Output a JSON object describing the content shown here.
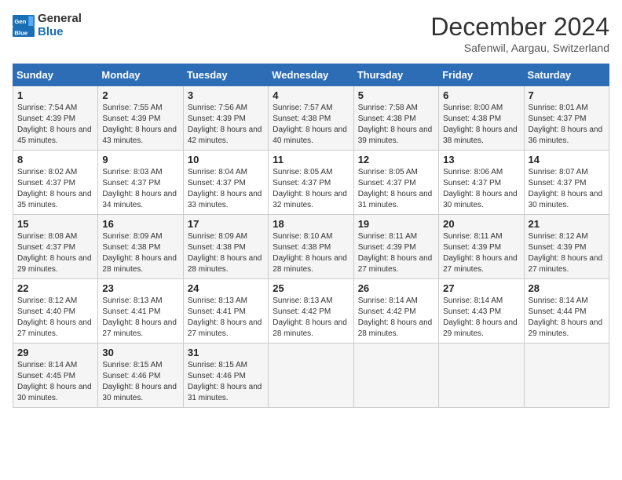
{
  "logo": {
    "general": "General",
    "blue": "Blue"
  },
  "title": "December 2024",
  "location": "Safenwil, Aargau, Switzerland",
  "days_of_week": [
    "Sunday",
    "Monday",
    "Tuesday",
    "Wednesday",
    "Thursday",
    "Friday",
    "Saturday"
  ],
  "weeks": [
    [
      {
        "day": "1",
        "sunrise": "Sunrise: 7:54 AM",
        "sunset": "Sunset: 4:39 PM",
        "daylight": "Daylight: 8 hours and 45 minutes."
      },
      {
        "day": "2",
        "sunrise": "Sunrise: 7:55 AM",
        "sunset": "Sunset: 4:39 PM",
        "daylight": "Daylight: 8 hours and 43 minutes."
      },
      {
        "day": "3",
        "sunrise": "Sunrise: 7:56 AM",
        "sunset": "Sunset: 4:39 PM",
        "daylight": "Daylight: 8 hours and 42 minutes."
      },
      {
        "day": "4",
        "sunrise": "Sunrise: 7:57 AM",
        "sunset": "Sunset: 4:38 PM",
        "daylight": "Daylight: 8 hours and 40 minutes."
      },
      {
        "day": "5",
        "sunrise": "Sunrise: 7:58 AM",
        "sunset": "Sunset: 4:38 PM",
        "daylight": "Daylight: 8 hours and 39 minutes."
      },
      {
        "day": "6",
        "sunrise": "Sunrise: 8:00 AM",
        "sunset": "Sunset: 4:38 PM",
        "daylight": "Daylight: 8 hours and 38 minutes."
      },
      {
        "day": "7",
        "sunrise": "Sunrise: 8:01 AM",
        "sunset": "Sunset: 4:37 PM",
        "daylight": "Daylight: 8 hours and 36 minutes."
      }
    ],
    [
      {
        "day": "8",
        "sunrise": "Sunrise: 8:02 AM",
        "sunset": "Sunset: 4:37 PM",
        "daylight": "Daylight: 8 hours and 35 minutes."
      },
      {
        "day": "9",
        "sunrise": "Sunrise: 8:03 AM",
        "sunset": "Sunset: 4:37 PM",
        "daylight": "Daylight: 8 hours and 34 minutes."
      },
      {
        "day": "10",
        "sunrise": "Sunrise: 8:04 AM",
        "sunset": "Sunset: 4:37 PM",
        "daylight": "Daylight: 8 hours and 33 minutes."
      },
      {
        "day": "11",
        "sunrise": "Sunrise: 8:05 AM",
        "sunset": "Sunset: 4:37 PM",
        "daylight": "Daylight: 8 hours and 32 minutes."
      },
      {
        "day": "12",
        "sunrise": "Sunrise: 8:05 AM",
        "sunset": "Sunset: 4:37 PM",
        "daylight": "Daylight: 8 hours and 31 minutes."
      },
      {
        "day": "13",
        "sunrise": "Sunrise: 8:06 AM",
        "sunset": "Sunset: 4:37 PM",
        "daylight": "Daylight: 8 hours and 30 minutes."
      },
      {
        "day": "14",
        "sunrise": "Sunrise: 8:07 AM",
        "sunset": "Sunset: 4:37 PM",
        "daylight": "Daylight: 8 hours and 30 minutes."
      }
    ],
    [
      {
        "day": "15",
        "sunrise": "Sunrise: 8:08 AM",
        "sunset": "Sunset: 4:37 PM",
        "daylight": "Daylight: 8 hours and 29 minutes."
      },
      {
        "day": "16",
        "sunrise": "Sunrise: 8:09 AM",
        "sunset": "Sunset: 4:38 PM",
        "daylight": "Daylight: 8 hours and 28 minutes."
      },
      {
        "day": "17",
        "sunrise": "Sunrise: 8:09 AM",
        "sunset": "Sunset: 4:38 PM",
        "daylight": "Daylight: 8 hours and 28 minutes."
      },
      {
        "day": "18",
        "sunrise": "Sunrise: 8:10 AM",
        "sunset": "Sunset: 4:38 PM",
        "daylight": "Daylight: 8 hours and 28 minutes."
      },
      {
        "day": "19",
        "sunrise": "Sunrise: 8:11 AM",
        "sunset": "Sunset: 4:39 PM",
        "daylight": "Daylight: 8 hours and 27 minutes."
      },
      {
        "day": "20",
        "sunrise": "Sunrise: 8:11 AM",
        "sunset": "Sunset: 4:39 PM",
        "daylight": "Daylight: 8 hours and 27 minutes."
      },
      {
        "day": "21",
        "sunrise": "Sunrise: 8:12 AM",
        "sunset": "Sunset: 4:39 PM",
        "daylight": "Daylight: 8 hours and 27 minutes."
      }
    ],
    [
      {
        "day": "22",
        "sunrise": "Sunrise: 8:12 AM",
        "sunset": "Sunset: 4:40 PM",
        "daylight": "Daylight: 8 hours and 27 minutes."
      },
      {
        "day": "23",
        "sunrise": "Sunrise: 8:13 AM",
        "sunset": "Sunset: 4:41 PM",
        "daylight": "Daylight: 8 hours and 27 minutes."
      },
      {
        "day": "24",
        "sunrise": "Sunrise: 8:13 AM",
        "sunset": "Sunset: 4:41 PM",
        "daylight": "Daylight: 8 hours and 27 minutes."
      },
      {
        "day": "25",
        "sunrise": "Sunrise: 8:13 AM",
        "sunset": "Sunset: 4:42 PM",
        "daylight": "Daylight: 8 hours and 28 minutes."
      },
      {
        "day": "26",
        "sunrise": "Sunrise: 8:14 AM",
        "sunset": "Sunset: 4:42 PM",
        "daylight": "Daylight: 8 hours and 28 minutes."
      },
      {
        "day": "27",
        "sunrise": "Sunrise: 8:14 AM",
        "sunset": "Sunset: 4:43 PM",
        "daylight": "Daylight: 8 hours and 29 minutes."
      },
      {
        "day": "28",
        "sunrise": "Sunrise: 8:14 AM",
        "sunset": "Sunset: 4:44 PM",
        "daylight": "Daylight: 8 hours and 29 minutes."
      }
    ],
    [
      {
        "day": "29",
        "sunrise": "Sunrise: 8:14 AM",
        "sunset": "Sunset: 4:45 PM",
        "daylight": "Daylight: 8 hours and 30 minutes."
      },
      {
        "day": "30",
        "sunrise": "Sunrise: 8:15 AM",
        "sunset": "Sunset: 4:46 PM",
        "daylight": "Daylight: 8 hours and 30 minutes."
      },
      {
        "day": "31",
        "sunrise": "Sunrise: 8:15 AM",
        "sunset": "Sunset: 4:46 PM",
        "daylight": "Daylight: 8 hours and 31 minutes."
      },
      null,
      null,
      null,
      null
    ]
  ]
}
